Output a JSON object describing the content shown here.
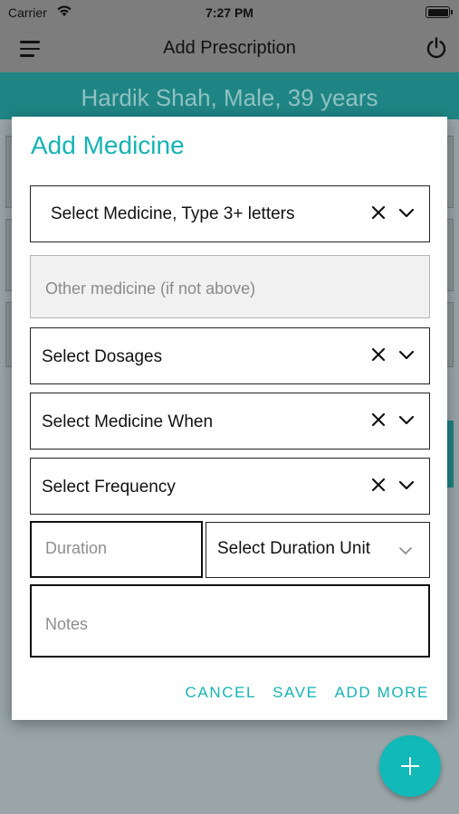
{
  "status_bar": {
    "carrier": "Carrier",
    "time": "7:27 PM"
  },
  "nav_bar": {
    "title": "Add Prescription",
    "menu_icon": "hamburger-menu-icon",
    "power_icon": "power-icon"
  },
  "banner": {
    "patient": "Hardik Shah, Male, 39 years",
    "color": "#1f8584"
  },
  "dialog": {
    "title": "Add Medicine",
    "medicine_select": {
      "label": "Select Medicine, Type 3+ letters"
    },
    "other_medicine": {
      "placeholder": "Other medicine (if not above)"
    },
    "dosages_select": {
      "label": "Select Dosages"
    },
    "when_select": {
      "label": "Select Medicine When"
    },
    "frequency_select": {
      "label": "Select Frequency"
    },
    "duration": {
      "placeholder": "Duration"
    },
    "duration_unit_select": {
      "label": "Select Duration Unit"
    },
    "notes": {
      "placeholder": "Notes"
    },
    "actions": {
      "cancel": "CANCEL",
      "save": "SAVE",
      "add_more": "ADD MORE"
    }
  },
  "colors": {
    "accent": "#16b3b3",
    "fab": "#11b9b9"
  }
}
